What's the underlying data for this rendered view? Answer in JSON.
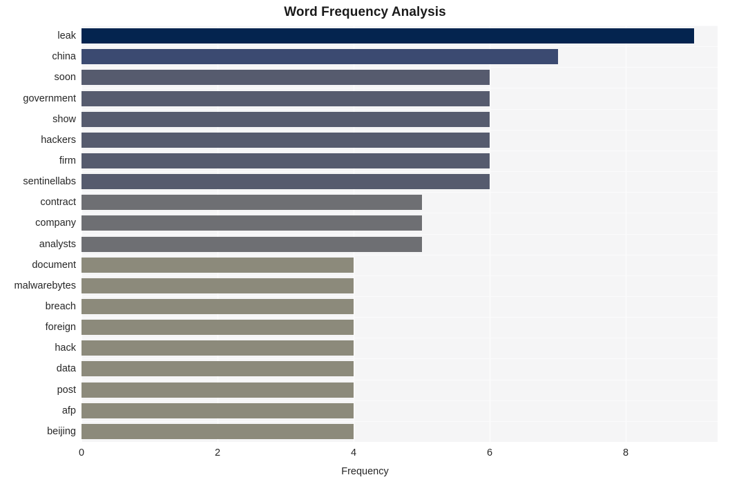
{
  "chart_data": {
    "type": "bar",
    "orientation": "horizontal",
    "title": "Word Frequency Analysis",
    "xlabel": "Frequency",
    "ylabel": "",
    "xlim": [
      0,
      9.35
    ],
    "xticks": [
      0,
      2,
      4,
      6,
      8
    ],
    "xtick_labels": [
      "0",
      "2",
      "4",
      "6",
      "8"
    ],
    "grid": true,
    "legend": null,
    "categories": [
      "leak",
      "china",
      "soon",
      "government",
      "show",
      "hackers",
      "firm",
      "sentinellabs",
      "contract",
      "company",
      "analysts",
      "document",
      "malwarebytes",
      "breach",
      "foreign",
      "hack",
      "data",
      "post",
      "afp",
      "beijing"
    ],
    "values": [
      9,
      7,
      6,
      6,
      6,
      6,
      6,
      6,
      5,
      5,
      5,
      4,
      4,
      4,
      4,
      4,
      4,
      4,
      4,
      4
    ],
    "bar_colors": [
      "#04244f",
      "#3b4a71",
      "#565b6e",
      "#565b6e",
      "#565b6e",
      "#565b6e",
      "#565b6e",
      "#565b6e",
      "#6e6f73",
      "#6e6f73",
      "#6e6f73",
      "#8c8a7b",
      "#8c8a7b",
      "#8c8a7b",
      "#8c8a7b",
      "#8c8a7b",
      "#8c8a7b",
      "#8c8a7b",
      "#8c8a7b",
      "#8c8a7b"
    ]
  },
  "style": {
    "figure_background": "#ffffff",
    "plot_background": "#f5f5f6",
    "gridline_color": "#ffffff",
    "text_color": "#262626",
    "title_color": "#1a1a1a"
  }
}
